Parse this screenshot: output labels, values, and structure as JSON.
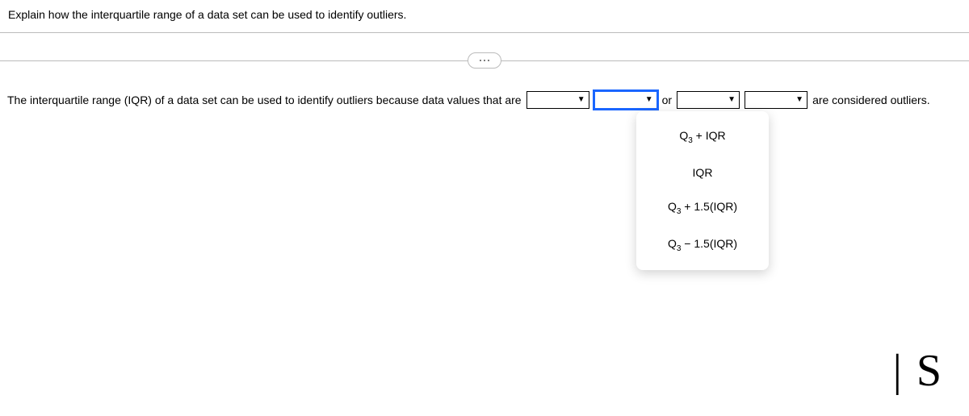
{
  "question": "Explain how the interquartile range of a data set can be used to identify outliers.",
  "answer": {
    "prefix": "The interquartile range (IQR) of a data set can be used to identify outliers because data values that are",
    "connector": "or",
    "suffix": "are considered outliers."
  },
  "dropdown_options": [
    "Q3 + IQR",
    "IQR",
    "Q3 + 1.5(IQR)",
    "Q3 − 1.5(IQR)"
  ],
  "handwriting": "| S"
}
